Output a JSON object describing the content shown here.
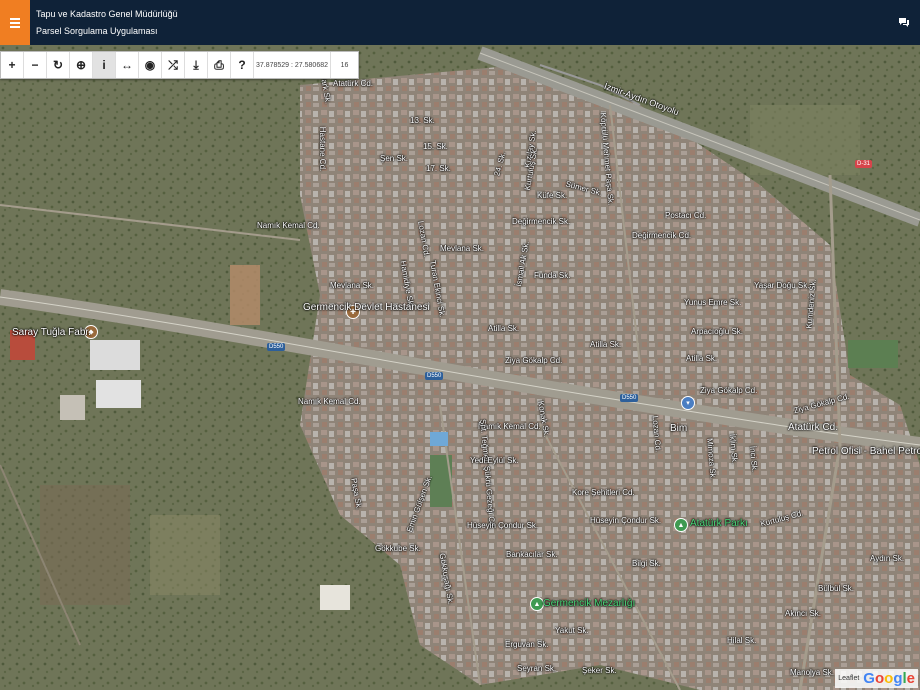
{
  "header": {
    "title_line1": "Tapu ve Kadastro Genel Müdürlüğü",
    "title_line2": "Parsel Sorgulama Uygulaması",
    "menu_icon": "hamburger-icon",
    "chat_icon": "chat-icon",
    "background_color": "#0f2238",
    "accent_color": "#f07e22"
  },
  "toolbar": {
    "buttons": [
      {
        "name": "zoom-in-button",
        "glyph": "+"
      },
      {
        "name": "zoom-out-button",
        "glyph": "−"
      },
      {
        "name": "refresh-button",
        "glyph": "↻"
      },
      {
        "name": "locate-button",
        "glyph": "⊕"
      },
      {
        "name": "info-button",
        "glyph": "i"
      },
      {
        "name": "measure-line-button",
        "glyph": "↔"
      },
      {
        "name": "view-button",
        "glyph": "◉"
      },
      {
        "name": "shuffle-button",
        "glyph": "⤮"
      },
      {
        "name": "download-button",
        "glyph": "⤓"
      },
      {
        "name": "print-button",
        "glyph": "⎙"
      },
      {
        "name": "help-button",
        "glyph": "?"
      }
    ],
    "coordinates": "37.878529 : 27.580682",
    "zoom_level": "16"
  },
  "map": {
    "labels": {
      "ataturk_cd_top": "Atatürk Cd.",
      "hastane_cd": "Hastane Cd.",
      "park_sk": "Park Sk.",
      "sen_sk": "Şen Sk.",
      "sk13": "13. Sk.",
      "sk15": "15. Sk.",
      "sk17": "17. Sk.",
      "sk24": "24. Sk.",
      "kizilay": "Kızılay Sk.",
      "kurtulus": "Kurtuluş Sk.",
      "koprulu": "Köprülü Mehmet Paşa Sk.",
      "izmir_aydin": "İzmir-Aydın Otoyolu",
      "d31": "D-31",
      "sumer": "Sümer Sk.",
      "kufe": "Küfe Sk.",
      "degirmencik_sk": "Değirmencik Sk.",
      "degirmencik_cd": "Değirmencik Cd.",
      "postaci": "Postacı Cd.",
      "namik_kemal_cd_n": "Namık Kemal Cd.",
      "lozan": "Lozan Cd.",
      "hamidiye": "Hamidiye Sk.",
      "turan_ekinci": "Turan Ekinci Sk.",
      "mevlana_sk": "Mevlana Sk.",
      "funda": "Funda Sk.",
      "ismail": "İsmail Ak Sk.",
      "yasar_dogu": "Yaşar Doğu Sk.",
      "vurus_emre": "Yunus Emre Sk.",
      "arpacioglu": "Arpacıoğlu Sk.",
      "kuruyemis": "Kumdeniz Sk.",
      "mevlana_sk2": "Mevlana Sk.",
      "hospital": "Germencik Devlet Hastanesi",
      "saray": "Saray Tuğla Fabr.",
      "d550_1": "D550",
      "d550_2": "D550",
      "d550_3": "D550",
      "atilla_1": "Atilla Sk.",
      "atilla_2": "Atilla Sk.",
      "atilla_3": "Atilla Sk.",
      "ziya_1": "Ziya Gökalp Cd.",
      "ziya_2": "Ziya Gökalp Cd.",
      "ziya_3": "Ziya Gökalp Cd.",
      "namik_kemal_s": "Namık Kemal Cd.",
      "namik_kemal_s2": "Namık Kemal Cd.",
      "sehit_tegmen": "Şht. Teğmen Şükrü Gezeği Cd.",
      "konak": "Konak Sk.",
      "lozan2": "Lozan Cd.",
      "bim": "Bim",
      "ataturk_cd_s": "Atatürk Cd.",
      "petrol": "Petrol Ofisi - Bahel Petrol",
      "yedieylul": "Yedi Eylül Sk.",
      "kore": "Kore Şehitleri Cd.",
      "husen_1": "Hüseyin Çondur Sk.",
      "husen_2": "Hüseyin Çondur Sk.",
      "ataturk_park": "Atatürk Parkı",
      "kurtulus_s": "Kurtuluş Cd.",
      "bankacilar": "Bankacılar Sk.",
      "gokkube": "Gökkube Sk.",
      "bilgi": "Bilgi Sk.",
      "mezarlik": "Germencik Mezarlığı",
      "yakut": "Yakut Sk.",
      "hilal": "Hilal Sk.",
      "akinci": "Akıncı Sk.",
      "bulbul": "Bülbül Sk.",
      "aydin": "Aydın Sk.",
      "manolya": "Manolya Sk.",
      "seyran": "Seyran Sk.",
      "seker": "Şeker Sk.",
      "erguvan": "Erguvan Sk.",
      "inci": "İnci Sk.",
      "emin": "Emin Gülşen Sk.",
      "pasa": "Paşa Sk.",
      "gokkusagi": "Gökkuşağı Sk.",
      "mimoza": "Mimoza Sk.",
      "iklim": "İklim Sk."
    },
    "attribution": "Leaflet",
    "provider_logo": "Google"
  }
}
